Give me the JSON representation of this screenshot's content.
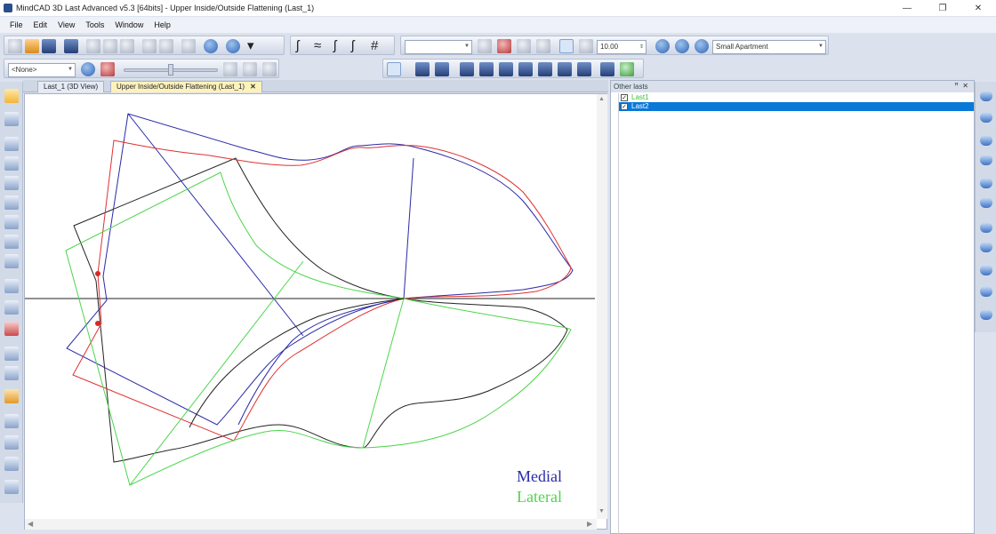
{
  "window": {
    "title": "MindCAD 3D Last Advanced v5.3 [64bits] - Upper Inside/Outside Flattening (Last_1)",
    "minimize": "—",
    "maximize": "❐",
    "close": "✕"
  },
  "menu": [
    "File",
    "Edit",
    "View",
    "Tools",
    "Window",
    "Help"
  ],
  "toolbar": {
    "unit_combo": "",
    "zoom_value": "10.00",
    "scene_preset": "Small Apartment",
    "selection_combo": "<None>"
  },
  "tabs": [
    {
      "label": "Last_1 (3D View)",
      "active": false
    },
    {
      "label": "Upper Inside/Outside Flattening (Last_1)",
      "active": true,
      "close": "✕"
    }
  ],
  "viewport": {
    "legend": {
      "medial": "Medial",
      "lateral": "Lateral"
    },
    "colors": {
      "medial": "#2a2aa8",
      "lateral": "#4cd64c",
      "last1_red": "#e03030",
      "outline": "#222222",
      "axis": "#222222"
    }
  },
  "panel": {
    "title": "Other lasts",
    "pin": "ꟸ",
    "close": "✕",
    "items": [
      {
        "label": "Last1",
        "checked": true,
        "selected": false
      },
      {
        "label": "Last2",
        "checked": true,
        "selected": true
      }
    ]
  }
}
